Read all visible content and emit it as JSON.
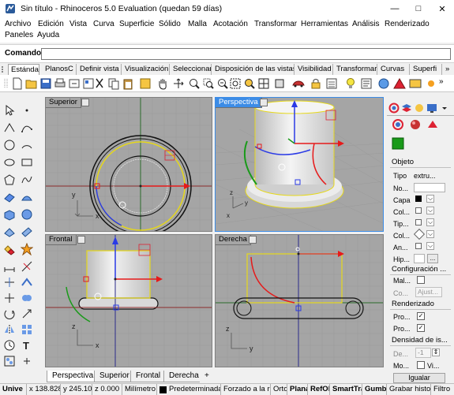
{
  "window": {
    "title": "Sin título - Rhinoceros 5.0 Evaluation (quedan 59 días)"
  },
  "menu": {
    "row1": [
      "Archivo",
      "Edición",
      "Vista",
      "Curva",
      "Superficie",
      "Sólido",
      "Malla",
      "Acotación",
      "Transformar",
      "Herramientas",
      "Análisis",
      "Renderizado"
    ],
    "row2": [
      "Paneles",
      "Ayuda"
    ]
  },
  "command": {
    "label": "Comando:",
    "value": ""
  },
  "toolbar_tabs": [
    "Estándar",
    "PlanosC",
    "Definir vista",
    "Visualización",
    "Seleccionar",
    "Disposición de las vistas",
    "Visibilidad",
    "Transformar",
    "Curvas",
    "Superfi"
  ],
  "toolbar_tabs_more": "»",
  "viewports": {
    "top": {
      "title": "Superior"
    },
    "perspective": {
      "title": "Perspectiva"
    },
    "front": {
      "title": "Frontal"
    },
    "right": {
      "title": "Derecha"
    },
    "axis_x": "x",
    "axis_y": "y",
    "axis_z": "z"
  },
  "viewport_tabs": [
    "Perspectiva",
    "Superior",
    "Frontal",
    "Derecha"
  ],
  "viewport_tab_add": "+",
  "properties": {
    "objeto_header": "Objeto",
    "rows": [
      {
        "label": "Tipo",
        "value": "extru..."
      },
      {
        "label": "No...",
        "value": ""
      },
      {
        "label": "Capa",
        "value": ""
      },
      {
        "label": "Col...",
        "value": ""
      },
      {
        "label": "Tip...",
        "value": ""
      },
      {
        "label": "Col...",
        "value": ""
      },
      {
        "label": "An...",
        "value": ""
      },
      {
        "label": "Hip...",
        "value": "..."
      }
    ],
    "config_header": "Configuración ...",
    "config_rows": [
      {
        "label": "Mal...",
        "value": ""
      },
      {
        "label": "Co...",
        "value": "Ajust..."
      }
    ],
    "render_header": "Renderizado",
    "render_rows": [
      {
        "label": "Pro...",
        "checked": true
      },
      {
        "label": "Pro...",
        "checked": true
      }
    ],
    "density_header": "Densidad de is...",
    "density_rows": [
      {
        "label": "De...",
        "value": "-1"
      },
      {
        "label": "Mo...",
        "value": "Vi..."
      }
    ],
    "match_button": "Igualar"
  },
  "status": {
    "x": "x 138.828",
    "y": "y 245.107",
    "z": "z 0.000",
    "units": "Milímetro",
    "layer": "Predeterminada",
    "grid_snap": "Forzado a la rejilla",
    "ortho": "Orto",
    "planar": "Planar",
    "osnap": "RefObj",
    "smarttrack": "SmartTrack",
    "gumball": "Gumball",
    "record_history": "Grabar historial",
    "filter": "Filtro"
  },
  "colors": {
    "accent": "#3c8ce6",
    "viewport_bg": "#a5a5a5",
    "grid_line": "#9a9a9a",
    "grid_major": "#8a8a8a"
  }
}
